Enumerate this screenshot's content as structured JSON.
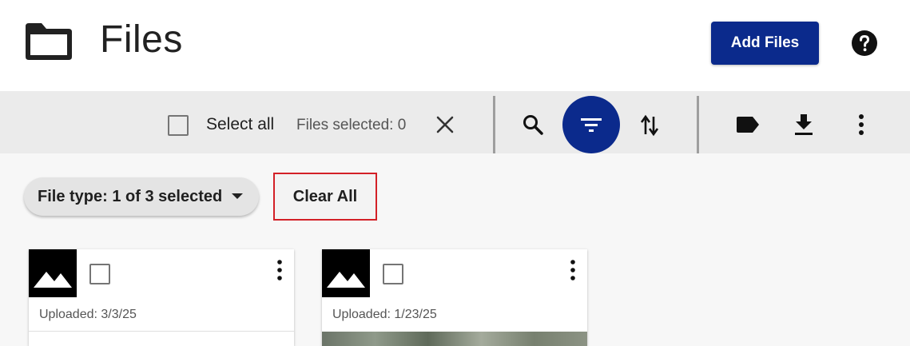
{
  "header": {
    "title": "Files",
    "folder_icon": "folder-icon",
    "add_files_label": "Add Files",
    "help_icon": "help-icon",
    "accent_color": "#0b2a8c"
  },
  "toolbar": {
    "select_all_label": "Select all",
    "files_selected_text": "Files selected: 0",
    "icons": [
      "close-icon",
      "search-icon",
      "filter-icon",
      "sort-icon",
      "label-icon",
      "download-icon",
      "more-vert-icon"
    ]
  },
  "filters": {
    "file_type_chip": "File type: 1 of 3 selected",
    "clear_all_label": "Clear All",
    "highlight_color": "#d32027"
  },
  "files": [
    {
      "uploaded": "Uploaded: 3/3/25",
      "has_preview": false
    },
    {
      "uploaded": "Uploaded: 1/23/25",
      "has_preview": true
    }
  ]
}
